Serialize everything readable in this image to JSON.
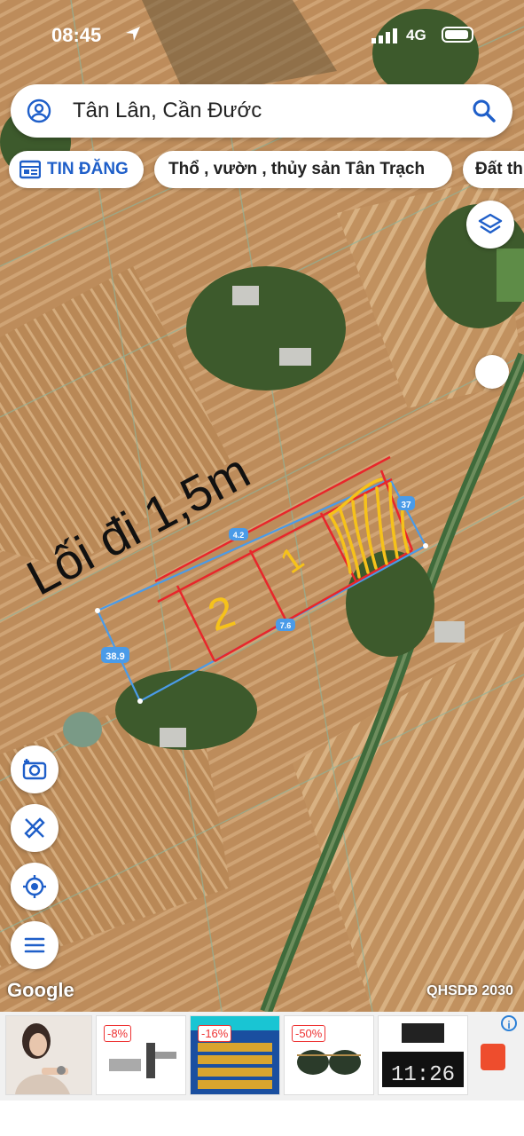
{
  "status": {
    "time": "08:45",
    "network": "4G"
  },
  "search": {
    "query": "Tân Lân, Cần Đước"
  },
  "chips": [
    {
      "label": "TIN ĐĂNG"
    },
    {
      "label": "Thổ , vườn , thủy sản Tân Trạch"
    },
    {
      "label": "Đất th"
    }
  ],
  "map": {
    "annotation": "Lối đi 1,5m",
    "plot_labels": [
      "1",
      "2"
    ],
    "dimension_labels": [
      "38.9",
      "37",
      "4.2",
      "7.6"
    ],
    "attribution": "Google",
    "overlay_label": "QHSDĐ 2030"
  },
  "ads": {
    "discounts": [
      "-8%",
      "-16%",
      "-50%"
    ],
    "clock_display": "11:26"
  },
  "colors": {
    "brand_blue": "#1f5fc9",
    "plot_red": "#e8262b",
    "hatch_yellow": "#f6c21a",
    "parcel_blue": "#4a9be8"
  }
}
